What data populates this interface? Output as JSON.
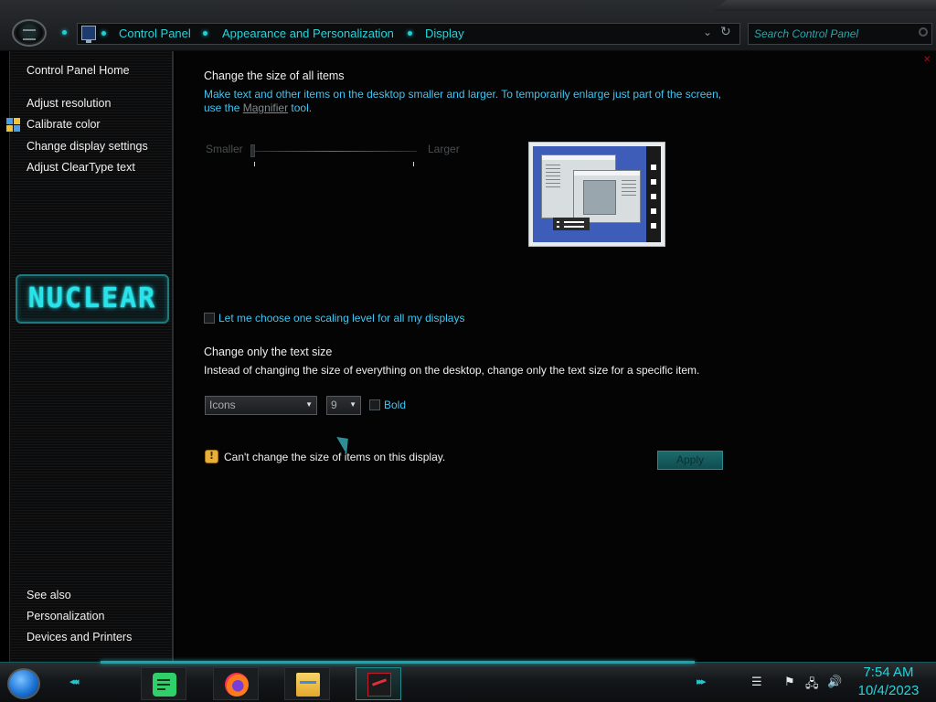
{
  "window": {
    "breadcrumbs": [
      "Control Panel",
      "Appearance and Personalization",
      "Display"
    ],
    "search_placeholder": "Search Control Panel"
  },
  "sidebar": {
    "home": "Control Panel Home",
    "tasks": [
      "Adjust resolution",
      "Calibrate color",
      "Change display settings",
      "Adjust ClearType text"
    ],
    "logo_text": "NUCLEAR",
    "see_also_heading": "See also",
    "see_also": [
      "Personalization",
      "Devices and Printers"
    ]
  },
  "main": {
    "size_heading": "Change the size of all items",
    "size_desc_line1": "Make text and other items on the desktop smaller and larger. To temporarily enlarge just part of the screen,",
    "size_desc_prefix": "use the",
    "magnifier_link": "Magnifier",
    "size_desc_suffix": "tool.",
    "slider_min_label": "Smaller",
    "slider_max_label": "Larger",
    "slider_value": 0,
    "scaling_checkbox_label": "Let me choose one scaling level for all my displays",
    "scaling_checked": false,
    "text_heading": "Change only the text size",
    "text_desc": "Instead of changing the size of everything on the desktop, change only the text size for a specific item.",
    "item_select": "Icons",
    "size_select": "9",
    "bold_label": "Bold",
    "bold_checked": false,
    "warning": "Can't change the size of items on this display.",
    "apply_label": "Apply"
  },
  "taskbar": {
    "apps": [
      "notes-app",
      "firefox",
      "file-explorer",
      "nuclear-theme-app"
    ],
    "tray_icons": [
      "show-desktop-icon",
      "flag-icon",
      "network-icon",
      "volume-icon"
    ],
    "time": "7:54 AM",
    "date": "10/4/2023"
  },
  "colors": {
    "accent": "#21d6dc",
    "link_blue": "#3fc6f2",
    "warning": "#e8b03a",
    "apply_button": "#1c6a6c"
  }
}
